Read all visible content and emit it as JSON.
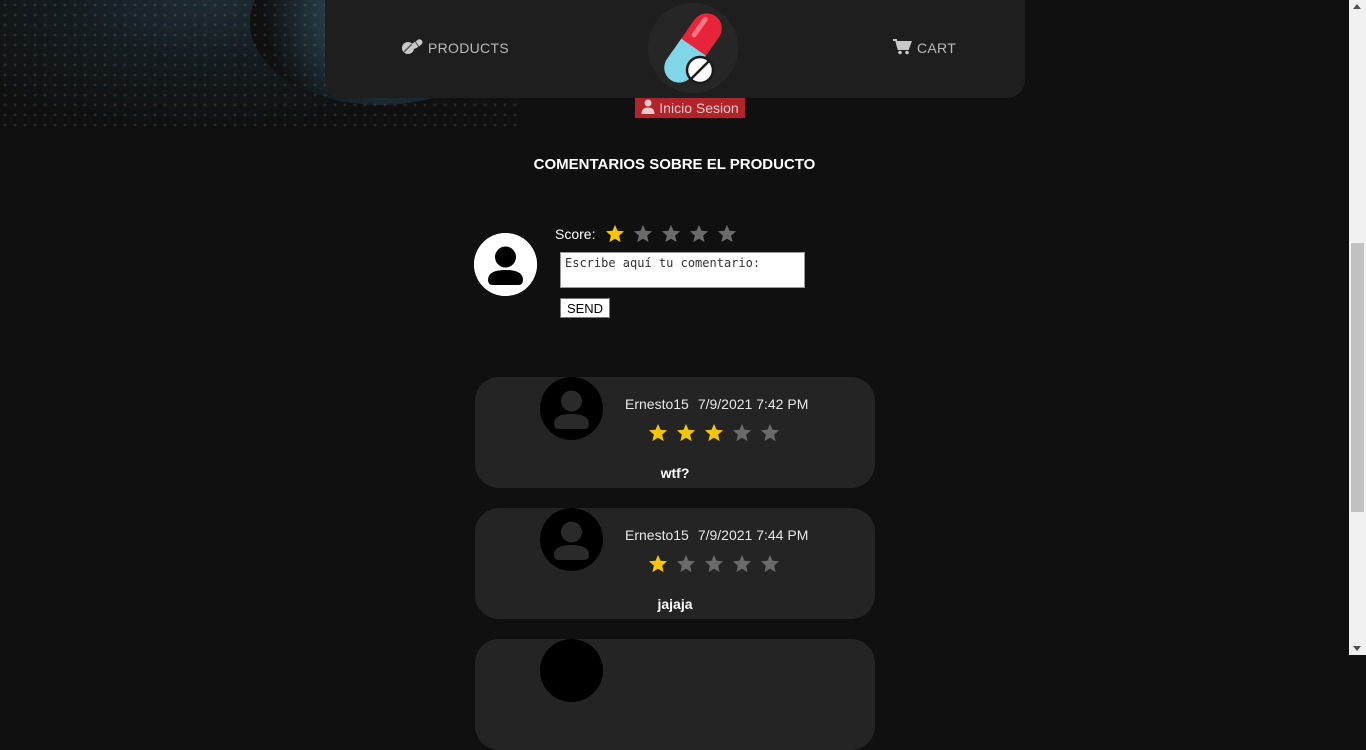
{
  "navbar": {
    "products_label": "PRODUCTS",
    "products_icon": "pills-icon",
    "cart_label": "CART",
    "cart_icon": "cart-icon",
    "logo": "capsule-logo"
  },
  "login": {
    "label": "Inicio Sesion",
    "icon": "user-icon"
  },
  "section_title": "COMENTARIOS SOBRE EL PRODUCTO",
  "new_comment": {
    "score_label": "Score:",
    "score": 1,
    "max_score": 5,
    "placeholder": "Escribe aquí tu comentario:",
    "send_label": "SEND"
  },
  "comments": [
    {
      "user": "Ernesto15",
      "date": "7/9/2021 7:42 PM",
      "rating": 3,
      "text": "wtf?"
    },
    {
      "user": "Ernesto15",
      "date": "7/9/2021 7:44 PM",
      "rating": 1,
      "text": "jajaja"
    }
  ],
  "colors": {
    "background": "#101010",
    "navbar": "#1e1e1e",
    "card": "#242424",
    "login_bg": "#b3242a",
    "star_active": "#f7c600",
    "star_inactive": "#6a6a6a"
  }
}
